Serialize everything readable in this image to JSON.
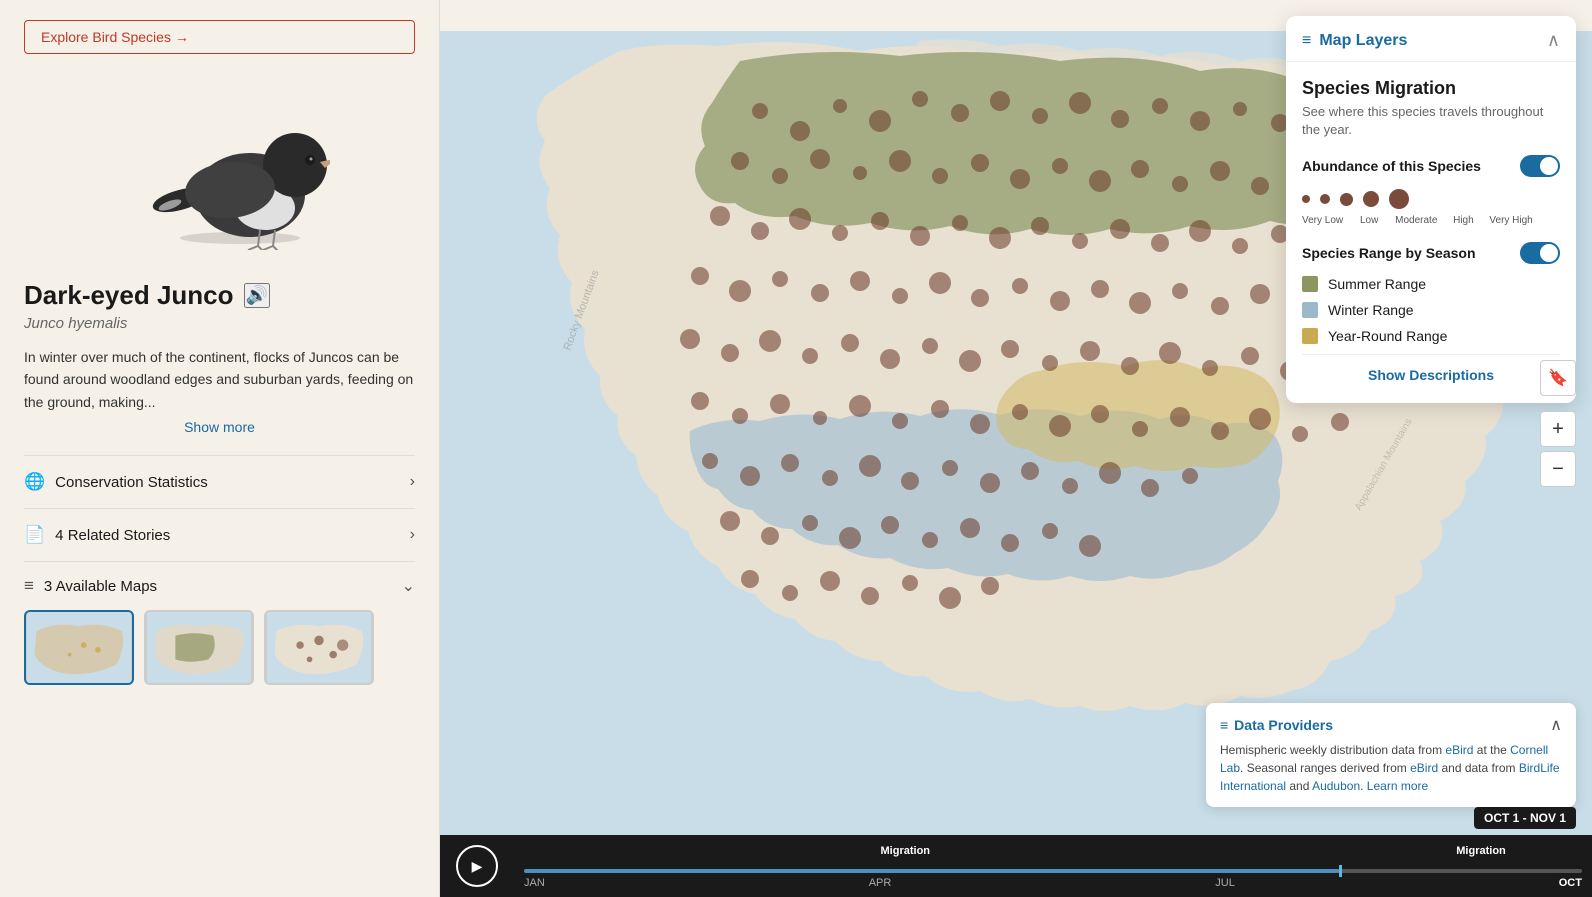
{
  "left_panel": {
    "explore_btn": "Explore Bird Species →",
    "bird_common_name": "Dark-eyed Junco",
    "bird_scientific_name": "Junco hyemalis",
    "bird_description": "In winter over much of the continent, flocks of Juncos can be found around woodland edges and suburban yards, feeding on the ground, making...",
    "show_more": "Show more",
    "conservation_icon": "🌐",
    "conservation_label": "Conservation Statistics",
    "related_icon": "📄",
    "related_count": "4",
    "related_label": "Related Stories",
    "maps_icon": "≡",
    "maps_count": "3",
    "maps_label": "Available Maps"
  },
  "map_layers": {
    "title": "Map Layers",
    "close_label": "∧",
    "section_title": "Species Migration",
    "section_desc": "See where this species travels throughout the year.",
    "abundance_label": "Abundance of this Species",
    "abundance_levels": [
      {
        "label": "Very Low",
        "size": 8
      },
      {
        "label": "Low",
        "size": 10
      },
      {
        "label": "Moderate",
        "size": 13
      },
      {
        "label": "High",
        "size": 16
      },
      {
        "label": "Very High",
        "size": 20
      }
    ],
    "range_label": "Species Range by Season",
    "range_items": [
      {
        "label": "Summer Range",
        "color": "#8d9660"
      },
      {
        "label": "Winter Range",
        "color": "#9db8c8"
      },
      {
        "label": "Year-Round Range",
        "color": "#c8aa50"
      }
    ],
    "show_descriptions": "Show Descriptions"
  },
  "data_providers": {
    "title": "Data Providers",
    "text_parts": [
      "Hemispheric weekly distribution data from ",
      "eBird",
      " at the ",
      "Cornell Lab",
      ". Seasonal ranges derived from ",
      "eBird",
      " and data from ",
      "BirdLife International",
      " and ",
      "Audubon",
      ". ",
      "Learn more"
    ]
  },
  "timeline": {
    "months": [
      "JAN",
      "APR",
      "JUL",
      "OCT"
    ],
    "migration_labels": [
      "Migration",
      "Migration"
    ],
    "current_date": "OCT 1 - NOV 1",
    "progress_pct": 77
  },
  "zoom": {
    "plus": "+",
    "minus": "−"
  }
}
